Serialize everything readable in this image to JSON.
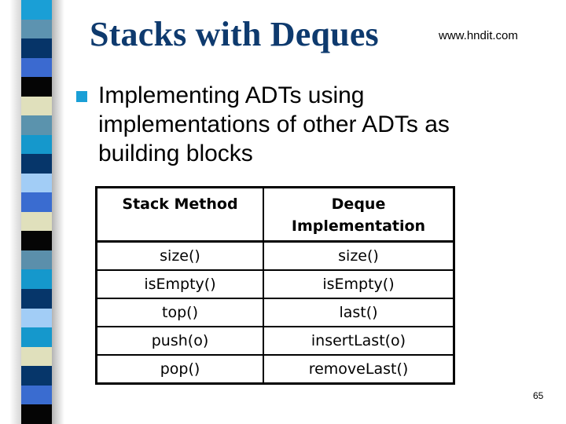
{
  "slide": {
    "title": "Stacks with Deques",
    "url": "www.hndit.com",
    "bullet_text": "Implementing ADTs using implementations of other ADTs as building blocks",
    "page_number": "65",
    "colors": {
      "title": "#0e3a6e",
      "bullet": "#1a9fd6"
    }
  },
  "decor": {
    "stripe_colors": [
      "#1a9fd6",
      "#5d93b0",
      "#063468",
      "#3b6ad0",
      "#050505",
      "#e0e0bc",
      "#5b93ad",
      "#1598cc",
      "#06366a",
      "#a2cdf6",
      "#3a6cd0",
      "#e0e0bc",
      "#050505",
      "#5b8fab",
      "#1598cc",
      "#06366a",
      "#a2cdf6",
      "#1598cc",
      "#e0e0bc",
      "#06366a",
      "#3a6cd0",
      "#050505"
    ]
  },
  "table": {
    "headers": [
      "Stack Method",
      "Deque Implementation"
    ],
    "rows": [
      [
        "size()",
        "size()"
      ],
      [
        "isEmpty()",
        "isEmpty()"
      ],
      [
        "top()",
        "last()"
      ],
      [
        "push(o)",
        "insertLast(o)"
      ],
      [
        "pop()",
        "removeLast()"
      ]
    ]
  }
}
